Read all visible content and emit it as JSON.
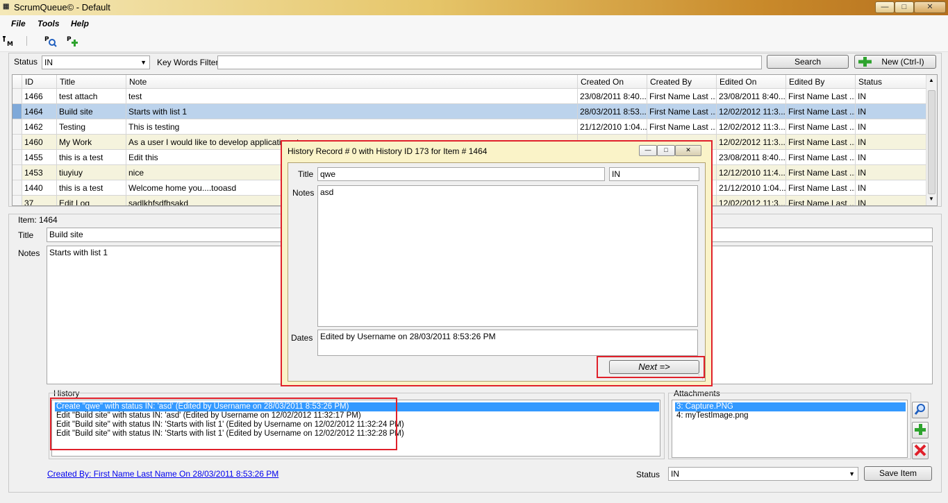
{
  "window": {
    "title": "ScrumQueue© - Default",
    "minimize": "—",
    "maximize": "□",
    "close": "✕"
  },
  "menu": {
    "file": "File",
    "tools": "Tools",
    "help": "Help"
  },
  "toolbar": {
    "icons": [
      "item-manager-icon",
      "search-item-icon",
      "add-item-icon"
    ]
  },
  "filter": {
    "status_label": "Status",
    "status_value": "IN",
    "keywords_label": "Key Words Filter",
    "keywords_value": "",
    "search_button": "Search",
    "new_button": "New (Ctrl-I)"
  },
  "grid": {
    "columns": [
      "ID",
      "Title",
      "Note",
      "Created On",
      "Created By",
      "Edited On",
      "Edited By",
      "Status"
    ],
    "rows": [
      {
        "id": "1466",
        "title": "test attach",
        "note": "test",
        "created_on": "23/08/2011 8:40...",
        "created_by": "First Name Last ...",
        "edited_on": "23/08/2011 8:40...",
        "edited_by": "First Name Last ...",
        "status": "IN"
      },
      {
        "id": "1464",
        "title": "Build site",
        "note": "Starts with list 1",
        "created_on": "28/03/2011 8:53...",
        "created_by": "First Name Last ...",
        "edited_on": "12/02/2012 11:3...",
        "edited_by": "First Name Last ...",
        "status": "IN"
      },
      {
        "id": "1462",
        "title": "Testing",
        "note": "This is testing",
        "created_on": "21/12/2010 1:04...",
        "created_by": "First Name Last ...",
        "edited_on": "12/02/2012 11:3...",
        "edited_by": "First Name Last ...",
        "status": "IN"
      },
      {
        "id": "1460",
        "title": "My Work",
        "note": "As a user I would like to develop applications t",
        "created_on": "",
        "created_by": "",
        "edited_on": "12/02/2012 11:3...",
        "edited_by": "First Name Last ...",
        "status": "IN"
      },
      {
        "id": "1455",
        "title": "this is a test",
        "note": "Edit this",
        "created_on": "",
        "created_by": "",
        "edited_on": "23/08/2011 8:40...",
        "edited_by": "First Name Last ...",
        "status": "IN"
      },
      {
        "id": "1453",
        "title": "tiuyiuy",
        "note": "nice",
        "created_on": "",
        "created_by": "",
        "edited_on": "12/12/2010 11:4...",
        "edited_by": "First Name Last ...",
        "status": "IN"
      },
      {
        "id": "1440",
        "title": "this is a test",
        "note": "Welcome home you....tooasd",
        "created_on": "",
        "created_by": "",
        "edited_on": "21/12/2010 1:04...",
        "edited_by": "First Name Last ...",
        "status": "IN"
      },
      {
        "id": "37",
        "title": "Edit Log",
        "note": "sadlkhfsdfhsakd",
        "created_on": "",
        "created_by": "",
        "edited_on": "12/02/2012 11:3...",
        "edited_by": "First Name Last ...",
        "status": "IN"
      }
    ]
  },
  "item": {
    "group_label": "Item: 1464",
    "title_label": "Title",
    "title_value": "Build site",
    "notes_label": "Notes",
    "notes_value": "Starts with list 1",
    "history_label": "History",
    "history": [
      "Create \"qwe\" with status IN: 'asd' (Edited by Username on 28/03/2011 8:53:26 PM)",
      "Edit \"Build site\" with status IN: 'asd' (Edited by Username on 12/02/2012 11:32:17 PM)",
      "Edit \"Build site\" with status IN: 'Starts with list 1' (Edited by Username on 12/02/2012 11:32:24 PM)",
      "Edit \"Build site\" with status IN: 'Starts with list 1' (Edited by Username on 12/02/2012 11:32:28 PM)"
    ],
    "attachments_label": "Attachments",
    "attachments": [
      "3: Capture.PNG",
      "4: myTestImage.png"
    ],
    "created_link": "Created By: First Name Last Name On 28/03/2011 8:53:26 PM",
    "status_label": "Status",
    "status_value": "IN",
    "save_button": "Save Item"
  },
  "dialog": {
    "title": "History Record # 0 with History ID 173 for Item # 1464",
    "title_label": "Title",
    "title_value": "qwe",
    "status_value": "IN",
    "notes_label": "Notes",
    "notes_value": "asd",
    "dates_label": "Dates",
    "dates_value": "Edited by Username on 28/03/2011 8:53:26 PM",
    "next_button": "Next =>",
    "minimize": "—",
    "maximize": "□",
    "close": "✕"
  },
  "colors": {
    "accent_red": "#e0202a",
    "selection_blue": "#3399ff",
    "row_selected": "#bcd3ec",
    "row_alt": "#f5f3dd"
  }
}
